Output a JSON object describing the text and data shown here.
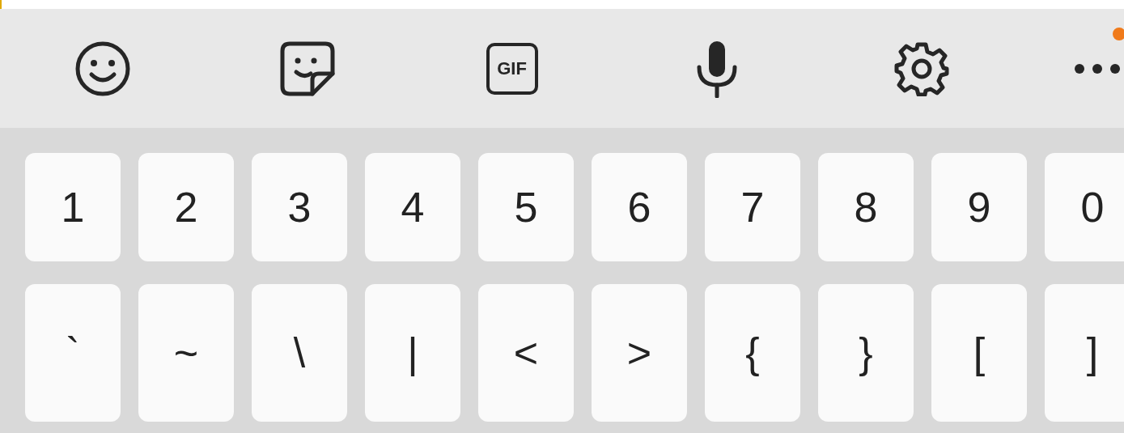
{
  "toolbar": [
    {
      "kind": "emoji"
    },
    {
      "kind": "sticker"
    },
    {
      "kind": "gif",
      "label": "GIF"
    },
    {
      "kind": "mic"
    },
    {
      "kind": "settings"
    },
    {
      "kind": "more",
      "notification": true
    }
  ],
  "keys": [
    [
      "1",
      "2",
      "3",
      "4",
      "5",
      "6",
      "7",
      "8",
      "9",
      "0"
    ],
    [
      "`",
      "~",
      "\\",
      "|",
      "<",
      ">",
      "{",
      "}",
      "[",
      "]"
    ]
  ]
}
